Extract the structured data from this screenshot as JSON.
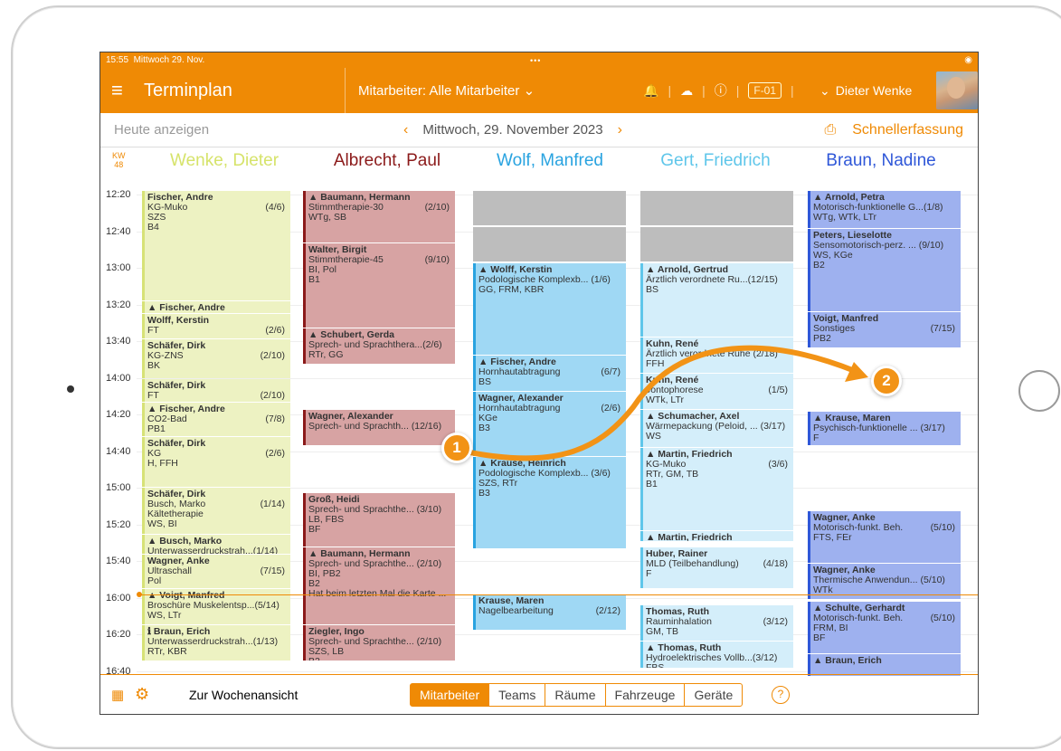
{
  "status": {
    "time": "15:55",
    "date": "Mittwoch 29. Nov.",
    "dots": "•••"
  },
  "app": {
    "title": "Terminplan",
    "staff_filter": "Mitarbeiter: Alle Mitarbeiter",
    "badge": "F-01",
    "user": "Dieter Wenke"
  },
  "subbar": {
    "today": "Heute anzeigen",
    "date": "Mittwoch, 29. November 2023",
    "quick": "Schnellerfassung"
  },
  "kw": {
    "label": "KW",
    "number": "48"
  },
  "columns": [
    {
      "name": "Wenke, Dieter",
      "color": "#d6e36a"
    },
    {
      "name": "Albrecht, Paul",
      "color": "#8b1a1a"
    },
    {
      "name": "Wolf, Manfred",
      "color": "#29a3e0"
    },
    {
      "name": "Gert, Friedrich",
      "color": "#5fc6ea"
    },
    {
      "name": "Braun, Nadine",
      "color": "#2f57d8"
    }
  ],
  "times": [
    "12:20",
    "12:40",
    "13:00",
    "13:20",
    "13:40",
    "14:00",
    "14:20",
    "14:40",
    "15:00",
    "15:20",
    "15:40",
    "16:00",
    "16:20",
    "16:40"
  ],
  "appointments": {
    "c1": [
      {
        "lines": [
          "Fischer, Andre",
          "KG-Muko",
          "SZS",
          "B4"
        ],
        "count": "(4/6)"
      },
      {
        "lines": [
          "▲ Fischer, Andre",
          "Wolff, Kerstin",
          "KG",
          "LFr"
        ],
        "count": "(2/6)"
      },
      {
        "lines": [
          "Wolff, Kerstin",
          "FT"
        ],
        "count": "(2/6)"
      },
      {
        "lines": [
          "Schäfer, Dirk",
          "KG-ZNS",
          "BK"
        ],
        "count": "(2/10)"
      },
      {
        "lines": [
          "Schäfer, Dirk",
          "FT"
        ],
        "count": "(2/10)"
      },
      {
        "lines": [
          "▲ Fischer, Andre",
          "CO2-Bad",
          "PB1"
        ],
        "count": "(7/8)"
      },
      {
        "lines": [
          "Schäfer, Dirk",
          "KG",
          "H, FFH"
        ],
        "count": "(2/6)"
      },
      {
        "lines": [
          "Schäfer, Dirk",
          "Busch, Marko",
          "Kältetherapie",
          "WS, BI"
        ],
        "count": "(1/14)"
      },
      {
        "lines": [
          "▲ Busch, Marko",
          "Unterwasserdruckstrah...(1/14)",
          "FFH, BI, KGe"
        ],
        "count": ""
      },
      {
        "lines": [
          "Wagner, Anke",
          "Ultraschall",
          "Pol"
        ],
        "count": "(7/15)"
      },
      {
        "lines": [
          "▲ Voigt, Manfred",
          "Broschüre Muskelentsp...(5/14)",
          "WS, LTr"
        ],
        "count": ""
      },
      {
        "lines": [
          "ℹ Braun, Erich",
          "Unterwasserdruckstrah...(1/13)",
          "RTr, KBR"
        ],
        "count": ""
      }
    ],
    "c2": [
      {
        "lines": [
          "▲ Baumann, Hermann",
          "Stimmtherapie-30",
          "WTg, SB"
        ],
        "count": "(2/10)"
      },
      {
        "lines": [
          "Walter, Birgit",
          "Stimmtherapie-45",
          "BI, Pol",
          "B1"
        ],
        "count": "(9/10)"
      },
      {
        "lines": [
          "▲ Schubert, Gerda",
          "Sprech- und Sprachthera...(2/6)",
          "RTr, GG"
        ],
        "count": ""
      },
      {
        "lines": [
          "Wagner, Alexander",
          "Sprech- und Sprachth... (12/16)"
        ],
        "count": ""
      },
      {
        "lines": [
          "Groß, Heidi",
          "Sprech- und Sprachthe... (3/10)",
          "LB, FBS",
          "BF"
        ],
        "count": ""
      },
      {
        "lines": [
          "▲ Baumann, Hermann",
          "Sprech- und Sprachthe... (2/10)",
          "BI, PB2",
          "B2",
          "Hat beim letzten Mal die Karte ..."
        ],
        "count": ""
      },
      {
        "lines": [
          "Ziegler, Ingo",
          "Sprech- und Sprachthe... (2/10)",
          "SZS, LB",
          "B2"
        ],
        "count": ""
      }
    ],
    "c3": [
      {
        "lines": [
          "▲ Wolff, Kerstin",
          "Podologische Komplexb... (1/6)",
          "GG, FRM, KBR"
        ],
        "count": ""
      },
      {
        "lines": [
          "▲ Fischer, Andre",
          "Hornhautabtragung",
          "BS"
        ],
        "count": "(6/7)"
      },
      {
        "lines": [
          "Wagner, Alexander",
          "Hornhautabtragung",
          "KGe",
          "B3"
        ],
        "count": "(2/6)"
      },
      {
        "lines": [
          "▲ Krause, Heinrich",
          "Podologische Komplexb... (3/6)",
          "SZS, RTr",
          "B3"
        ],
        "count": ""
      },
      {
        "lines": [
          "Krause, Maren",
          "Nagelbearbeitung"
        ],
        "count": "(2/12)"
      }
    ],
    "c4": [
      {
        "lines": [
          "▲ Arnold, Gertrud",
          "Ärztlich verordnete Ru...(12/15)",
          "BS"
        ],
        "count": ""
      },
      {
        "lines": [
          "Kuhn, René",
          "Ärztlich verordnete Ruhe (2/18)",
          "FFH"
        ],
        "count": ""
      },
      {
        "lines": [
          "Kuhn, René",
          "Jontophorese",
          "WTk, LTr"
        ],
        "count": "(1/5)"
      },
      {
        "lines": [
          "▲ Schumacher, Axel",
          "Wärmepackung (Peloid, ... (3/17)",
          "WS"
        ],
        "count": ""
      },
      {
        "lines": [
          "▲ Martin, Friedrich",
          "KG-Muko",
          "RTr, GM, TB",
          "B1"
        ],
        "count": "(3/6)"
      },
      {
        "lines": [
          "▲ Martin, Friedrich"
        ],
        "count": ""
      },
      {
        "lines": [
          "Huber, Rainer",
          "MLD (Teilbehandlung)",
          "F"
        ],
        "count": "(4/18)"
      },
      {
        "lines": [
          "Thomas, Ruth",
          "Rauminhalation",
          "GM, TB"
        ],
        "count": "(3/12)"
      },
      {
        "lines": [
          "▲ Thomas, Ruth",
          "Hydroelektrisches Vollb...(3/12)",
          "FBS"
        ],
        "count": ""
      }
    ],
    "c5": [
      {
        "lines": [
          "▲ Arnold, Petra",
          "Motorisch-funktionelle G...(1/8)",
          "WTg, WTk, LTr"
        ],
        "count": ""
      },
      {
        "lines": [
          "Peters, Lieselotte",
          "Sensomotorisch-perz. ... (9/10)",
          "WS, KGe",
          "B2"
        ],
        "count": ""
      },
      {
        "lines": [
          "Voigt, Manfred",
          "Sonstiges",
          "PB2"
        ],
        "count": "(7/15)"
      },
      {
        "lines": [
          "▲ Krause, Maren",
          "Psychisch-funktionelle ... (3/17)",
          "F"
        ],
        "count": ""
      },
      {
        "lines": [
          "Wagner, Anke",
          "Motorisch-funkt. Beh.",
          "FTS, FEr"
        ],
        "count": "(5/10)"
      },
      {
        "lines": [
          "Wagner, Anke",
          "Thermische Anwendun... (5/10)",
          "WTk"
        ],
        "count": ""
      },
      {
        "lines": [
          "▲ Schulte, Gerhardt",
          "Motorisch-funkt. Beh.",
          "FRM, BI",
          "BF"
        ],
        "count": "(5/10)"
      },
      {
        "lines": [
          "▲ Braun, Erich"
        ],
        "count": ""
      }
    ]
  },
  "bottom": {
    "week_view": "Zur Wochenansicht",
    "segments": [
      "Mitarbeiter",
      "Teams",
      "Räume",
      "Fahrzeuge",
      "Geräte"
    ],
    "help": "?"
  },
  "steps": [
    "1",
    "2"
  ]
}
